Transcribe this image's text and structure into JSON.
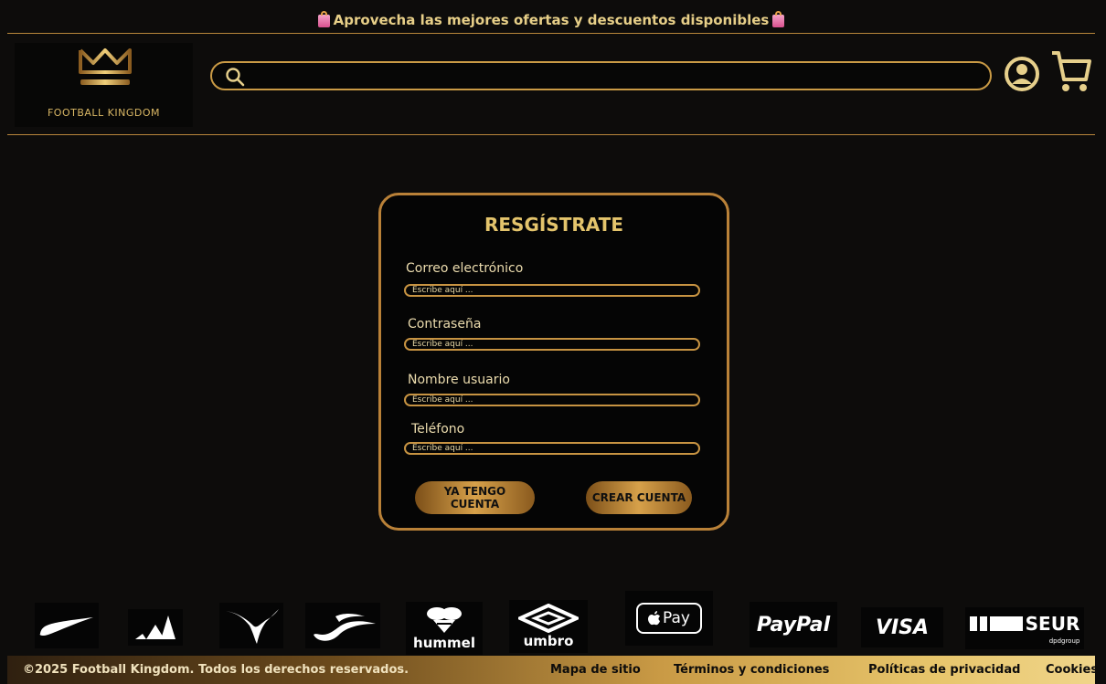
{
  "promo": {
    "text": "Aprovecha las mejores ofertas y descuentos disponibles"
  },
  "header": {
    "brand": "FOOTBALL KINGDOM",
    "search_value": ""
  },
  "register": {
    "title": "RESGÍSTRATE",
    "fields": [
      {
        "label": "Correo electrónico",
        "placeholder": "Escribe aquí ..."
      },
      {
        "label": "Contraseña",
        "placeholder": "Escribe aquí ..."
      },
      {
        "label": "Nombre usuario",
        "placeholder": "Escribe aquí ..."
      },
      {
        "label": "Teléfono",
        "placeholder": "Escribe aquí ..."
      }
    ],
    "have_account_label": "YA TENGO CUENTA",
    "create_account_label": "CREAR CUENTA"
  },
  "brands": {
    "hummel": "hummel",
    "umbro": "umbro",
    "applepay": "Pay",
    "paypal": "PayPal",
    "visa": "VISA",
    "seur": "SEUR",
    "seur_sub": "dpdgroup"
  },
  "footer": {
    "copyright": "©2025 Football Kingdom. Todos los derechos reservados.",
    "sitemap": "Mapa de sitio",
    "terms": "Términos y condiciones",
    "privacy": "Políticas de privacidad",
    "cookies": "Cookies"
  },
  "colors": {
    "gold": "#d7a14a",
    "background": "#0d0c0b",
    "border": "#b9863b"
  }
}
